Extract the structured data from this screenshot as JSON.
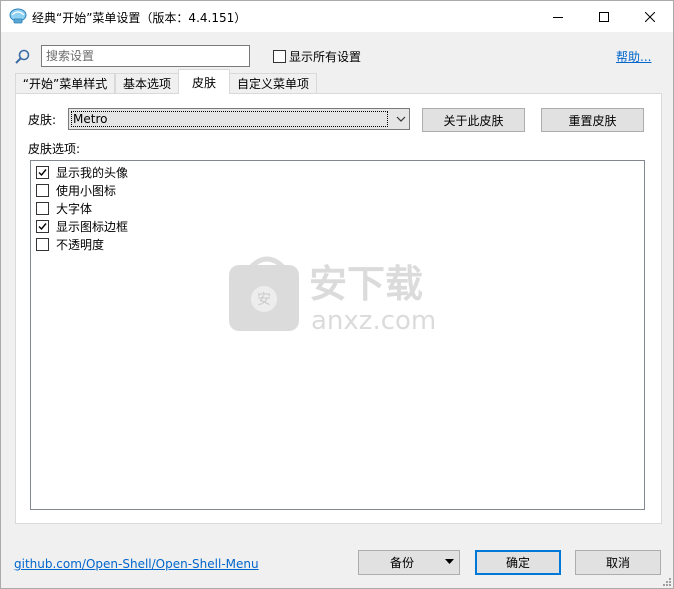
{
  "window": {
    "title": "经典“开始”菜单设置（版本：4.4.151）",
    "controls": {
      "minimize": "minimize-icon",
      "maximize": "maximize-icon",
      "close": "close-icon"
    }
  },
  "toolbar": {
    "search_placeholder": "搜索设置",
    "show_all_label": "显示所有设置",
    "show_all_checked": false,
    "help_label": "帮助..."
  },
  "tabs": [
    {
      "label": "“开始”菜单样式",
      "active": false
    },
    {
      "label": "基本选项",
      "active": false
    },
    {
      "label": "皮肤",
      "active": true
    },
    {
      "label": "自定义菜单项",
      "active": false
    }
  ],
  "skin_panel": {
    "skin_label": "皮肤:",
    "skin_value": "Metro",
    "about_button": "关于此皮肤",
    "reset_button": "重置皮肤",
    "options_label": "皮肤选项:",
    "options": [
      {
        "label": "显示我的头像",
        "checked": true
      },
      {
        "label": "使用小图标",
        "checked": false
      },
      {
        "label": "大字体",
        "checked": false
      },
      {
        "label": "显示图标边框",
        "checked": true
      },
      {
        "label": "不透明度",
        "checked": false
      }
    ]
  },
  "watermark": {
    "brand": "安下载",
    "domain": "anxz.com",
    "badge": "安"
  },
  "footer": {
    "github_link": "github.com/Open-Shell/Open-Shell-Menu",
    "backup_button": "备份",
    "ok_button": "确定",
    "cancel_button": "取消"
  },
  "colors": {
    "link": "#0066cc",
    "focus_border": "#0078d7",
    "window_bg": "#f0f0f0"
  }
}
